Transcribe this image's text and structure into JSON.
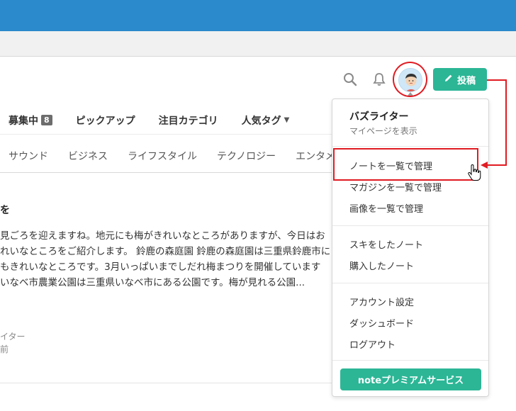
{
  "header": {
    "post_button_label": "投稿",
    "icons": [
      "search-icon",
      "bell-icon",
      "pencil-icon"
    ]
  },
  "nav": {
    "items": [
      {
        "label": "募集中",
        "badge": "8"
      },
      {
        "label": "ピックアップ"
      },
      {
        "label": "注目カテゴリ"
      },
      {
        "label": "人気タグ",
        "has_dropdown": true
      }
    ]
  },
  "categories": [
    "サウンド",
    "ビジネス",
    "ライフスタイル",
    "テクノロジー",
    "エンタメ"
  ],
  "article": {
    "partial_title": "を",
    "lines": [
      "見ごろを迎えますね。地元にも梅がきれいなところがありますが、今日はお",
      "れいなところをご紹介します。 鈴鹿の森庭園 鈴鹿の森庭園は三重県鈴鹿市に",
      "もきれいなところです。3月いっぱいまでしだれ梅まつりを開催しています",
      "いなべ市農業公園は三重県いなべ市にある公園です。梅が見れる公園..."
    ],
    "author_partial": "イター",
    "time_partial": "前"
  },
  "dropdown": {
    "user_name": "バズライター",
    "user_sub": "マイページを表示",
    "group1": [
      "ノートを一覧で管理",
      "マガジンを一覧で管理",
      "画像を一覧で管理"
    ],
    "group2": [
      "スキをしたノート",
      "購入したノート"
    ],
    "group3": [
      "アカウント設定",
      "ダッシュボード",
      "ログアウト"
    ],
    "premium_label": "noteプレミアムサービス"
  },
  "colors": {
    "accent": "#2cb696",
    "annotation": "#e01b22",
    "browser_chrome": "#2b8acb"
  }
}
